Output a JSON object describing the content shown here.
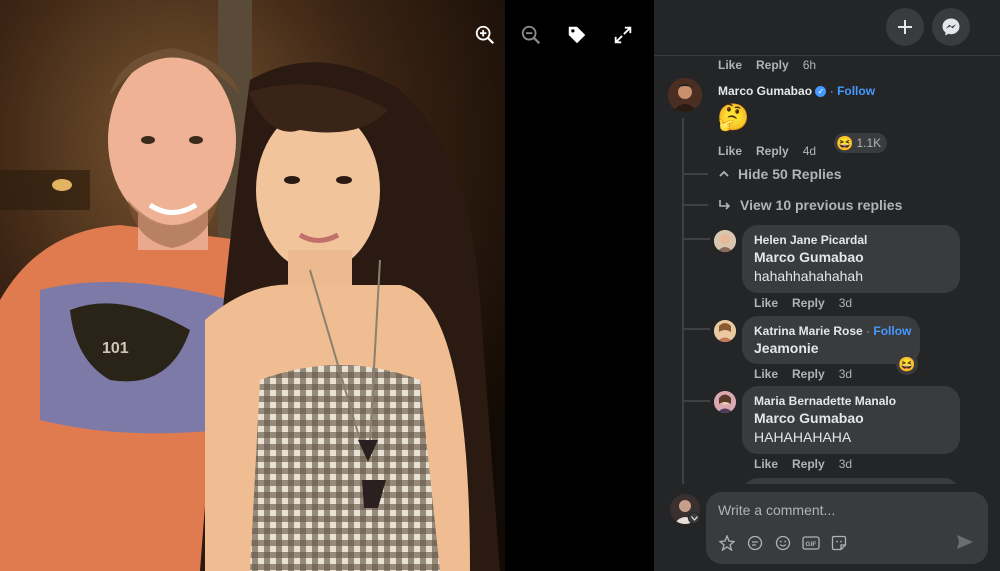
{
  "viewer": {
    "tools": [
      {
        "name": "zoom-in-icon"
      },
      {
        "name": "zoom-out-icon"
      },
      {
        "name": "tag-icon"
      },
      {
        "name": "fullscreen-icon"
      }
    ],
    "shirt_text": "101"
  },
  "panel": {
    "top_actions": {
      "like": "Like",
      "reply": "Reply",
      "time": "6h"
    },
    "main_comment": {
      "author": "Marco Gumabao",
      "follow": "Follow",
      "separator": "·",
      "emoji": "🤔",
      "like": "Like",
      "reply": "Reply",
      "time": "4d",
      "reaction_emoji": "😆",
      "reaction_count": "1.1K"
    },
    "hide_replies": "Hide 50 Replies",
    "view_previous": "View 10 previous replies",
    "replies": [
      {
        "author": "Helen Jane Picardal",
        "tag": "Marco Gumabao",
        "text": "hahahhahahahah",
        "like": "Like",
        "reply": "Reply",
        "time": "3d"
      },
      {
        "author": "Katrina Marie Rose",
        "follow": "Follow",
        "separator": "·",
        "text": "Jeamonie",
        "reaction_emoji": "😆",
        "like": "Like",
        "reply": "Reply",
        "time": "3d"
      },
      {
        "author": "Maria Bernadette Manalo",
        "tag": "Marco Gumabao",
        "text": "HAHAHAHAHA",
        "like": "Like",
        "reply": "Reply",
        "time": "3d"
      }
    ],
    "comment_input": {
      "placeholder": "Write a comment..."
    }
  },
  "colors": {
    "panel_bg": "#242526",
    "bubble_bg": "#3a3b3c",
    "link_blue": "#4599ff",
    "muted": "#b0b3b8"
  }
}
